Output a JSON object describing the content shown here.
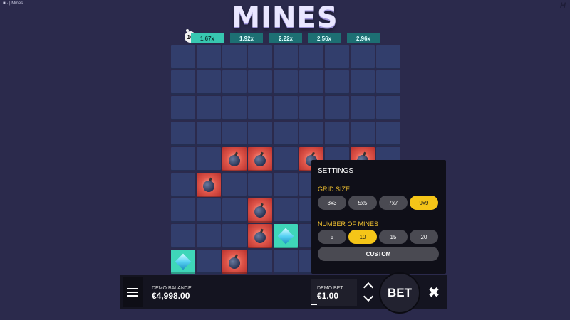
{
  "window": {
    "title": "Mines",
    "tab_prefix": "■ · |"
  },
  "corner_logo": "H",
  "game_title": "MINES",
  "mine_count": "10",
  "multipliers": [
    "1.67x",
    "1.92x",
    "2.22x",
    "2.56x",
    "2.96x"
  ],
  "grid": {
    "rows": 9,
    "cols": 9,
    "bombs": [
      [
        4,
        2
      ],
      [
        4,
        3
      ],
      [
        4,
        5
      ],
      [
        4,
        7
      ],
      [
        5,
        1
      ],
      [
        7,
        3
      ],
      [
        6,
        3
      ],
      [
        8,
        2
      ]
    ],
    "gems": [
      [
        7,
        4
      ],
      [
        8,
        0
      ]
    ]
  },
  "settings": {
    "title": "SETTINGS",
    "grid_size_label": "GRID SIZE",
    "grid_sizes": [
      "3x3",
      "5x5",
      "7x7",
      "9x9"
    ],
    "grid_size_selected": "9x9",
    "mines_label": "NUMBER OF MINES",
    "mines_options": [
      "5",
      "10",
      "15",
      "20"
    ],
    "mines_selected": "10",
    "custom_label": "CUSTOM"
  },
  "balance": {
    "label": "DEMO BALANCE",
    "value": "€4,998.00"
  },
  "bet": {
    "label": "DEMO BET",
    "value": "€1.00"
  },
  "bet_button_label": "BET",
  "close_label": "✖"
}
